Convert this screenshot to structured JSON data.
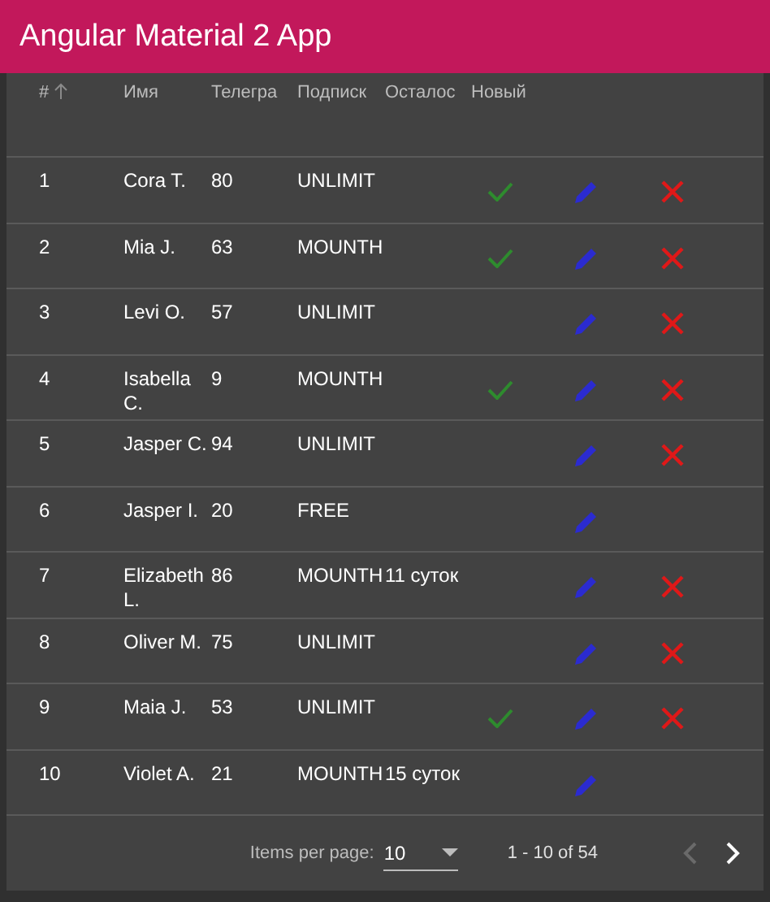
{
  "app_bar": {
    "title": "Angular Material 2 App"
  },
  "table": {
    "columns": [
      {
        "label": "#",
        "sorted": true
      },
      {
        "label": "Имя",
        "sorted": false
      },
      {
        "label": "Телегра",
        "sorted": false
      },
      {
        "label": "Подписк",
        "sorted": false
      },
      {
        "label": "Осталос",
        "sorted": false
      },
      {
        "label": "Новый",
        "sorted": false
      }
    ],
    "rows": [
      {
        "id": "1",
        "name": "Cora T.",
        "telegram": "80",
        "subscription": "UNLIMIT",
        "new": true,
        "deletable": true
      },
      {
        "id": "2",
        "name": "Mia J.",
        "telegram": "63",
        "subscription": "MOUNTH",
        "new": true,
        "deletable": true
      },
      {
        "id": "3",
        "name": "Levi O.",
        "telegram": "57",
        "subscription": "UNLIMIT",
        "new": false,
        "deletable": true
      },
      {
        "id": "4",
        "name": "Isabella C.",
        "telegram": "9",
        "subscription": "MOUNTH",
        "new": true,
        "deletable": true
      },
      {
        "id": "5",
        "name": "Jasper C.",
        "telegram": "94",
        "subscription": "UNLIMIT",
        "new": false,
        "deletable": true
      },
      {
        "id": "6",
        "name": "Jasper I.",
        "telegram": "20",
        "subscription": "FREE",
        "new": false,
        "deletable": false
      },
      {
        "id": "7",
        "name": "Elizabeth L.",
        "telegram": "86",
        "subscription": "MOUNTH",
        "remaining": "11 суток",
        "new": false,
        "deletable": true
      },
      {
        "id": "8",
        "name": "Oliver M.",
        "telegram": "75",
        "subscription": "UNLIMIT",
        "new": false,
        "deletable": true
      },
      {
        "id": "9",
        "name": "Maia J.",
        "telegram": "53",
        "subscription": "UNLIMIT",
        "new": true,
        "deletable": true
      },
      {
        "id": "10",
        "name": "Violet A.",
        "telegram": "21",
        "subscription": "MOUNTH",
        "remaining": "15 суток",
        "new": false,
        "deletable": false
      }
    ]
  },
  "paginator": {
    "items_per_page_label": "Items per page:",
    "page_size": "10",
    "range": "1 - 10 of 54",
    "prev_disabled": true,
    "next_disabled": false
  }
}
